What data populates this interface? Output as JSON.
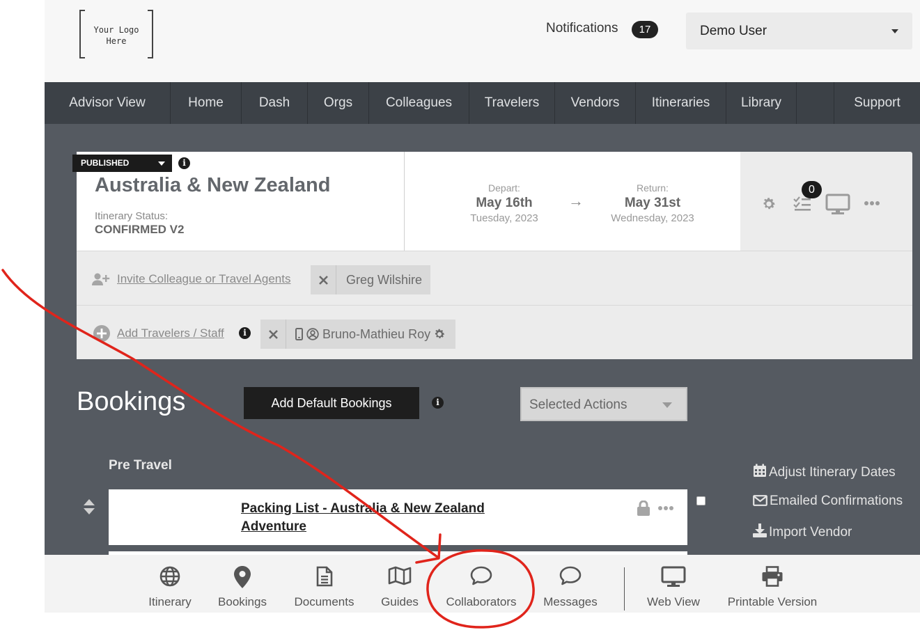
{
  "header": {
    "logo_line1": "Your Logo",
    "logo_line2": "Here",
    "notifications_label": "Notifications",
    "notifications_count": "17",
    "user_name": "Demo User"
  },
  "nav": {
    "items": [
      "Advisor View",
      "Home",
      "Dash",
      "Orgs",
      "Colleagues",
      "Travelers",
      "Vendors",
      "Itineraries",
      "Library",
      "Support"
    ]
  },
  "trip": {
    "status_pill": "PUBLISHED",
    "info_glyph": "i",
    "title": "Australia & New Zealand",
    "status_label": "Itinerary Status:",
    "status_value": "CONFIRMED V2",
    "depart_label": "Depart:",
    "depart_date": "May 16th",
    "depart_sub": "Tuesday, 2023",
    "arrow": "→",
    "return_label": "Return:",
    "return_date": "May 31st",
    "return_sub": "Wednesday, 2023",
    "checklist_count": "0",
    "invite_link": "Invite Colleague or Travel Agents",
    "colleague_chip": "Greg Wilshire",
    "add_travelers_link": "Add Travelers / Staff",
    "traveler_chip": "Bruno-Mathieu Roy"
  },
  "bookings": {
    "title": "Bookings",
    "add_default_label": "Add Default Bookings",
    "selected_actions": "Selected Actions",
    "pre_travel": "Pre Travel",
    "card_title": "Packing List - Australia & New Zealand Adventure"
  },
  "side_actions": {
    "adjust_dates": "Adjust Itinerary Dates",
    "emailed": "Emailed Confirmations",
    "import_vendor": "Import Vendor"
  },
  "bottom_bar": {
    "items": [
      "Itinerary",
      "Bookings",
      "Documents",
      "Guides",
      "Collaborators",
      "Messages",
      "Web View",
      "Printable Version"
    ]
  },
  "colors": {
    "annotation": "#e0241b",
    "nav_bg": "#3c4147",
    "page_bg": "#555a61"
  }
}
